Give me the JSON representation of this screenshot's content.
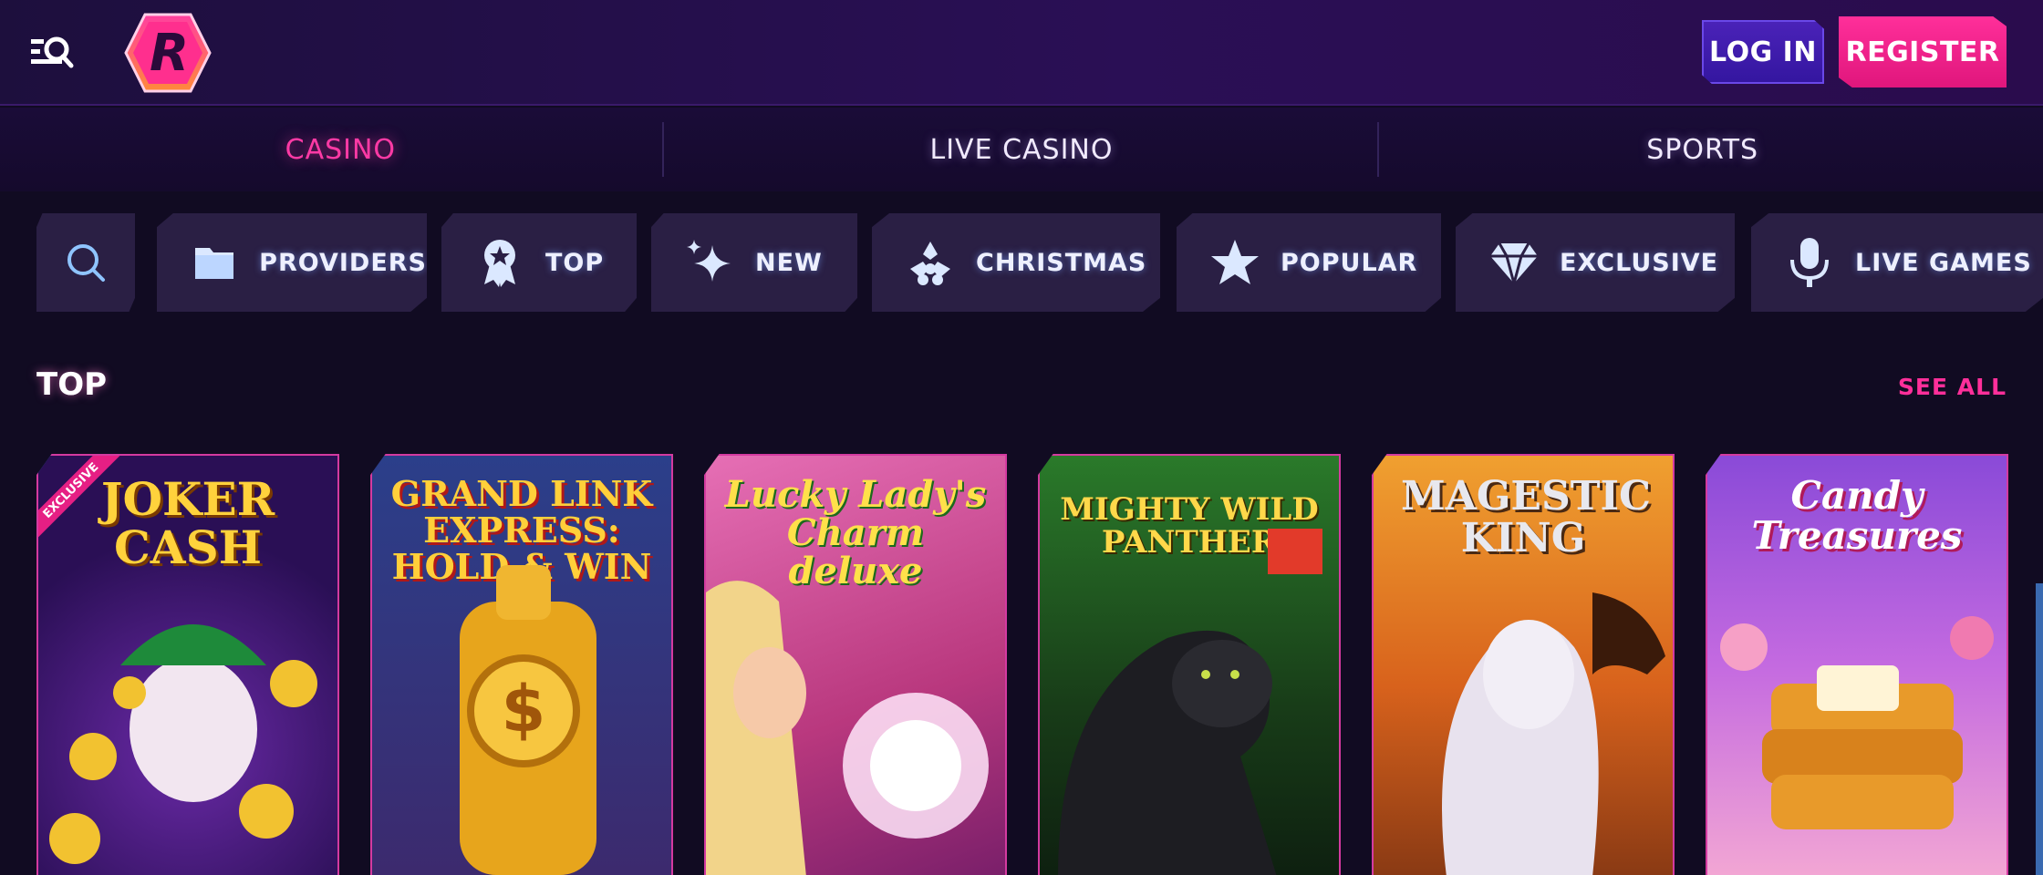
{
  "header": {
    "login_label": "LOG IN",
    "register_label": "REGISTER",
    "logo_letter": "R"
  },
  "topnav": {
    "tabs": [
      {
        "label": "CASINO",
        "active": true
      },
      {
        "label": "LIVE CASINO",
        "active": false
      },
      {
        "label": "SPORTS",
        "active": false
      }
    ]
  },
  "categories": [
    {
      "label": "",
      "icon": "search-icon"
    },
    {
      "label": "PROVIDERS",
      "icon": "folder-icon"
    },
    {
      "label": "TOP",
      "icon": "award-icon"
    },
    {
      "label": "NEW",
      "icon": "sparkles-icon"
    },
    {
      "label": "CHRISTMAS",
      "icon": "holly-icon"
    },
    {
      "label": "POPULAR",
      "icon": "star-icon"
    },
    {
      "label": "EXCLUSIVE",
      "icon": "diamond-icon"
    },
    {
      "label": "LIVE GAMES",
      "icon": "microphone-icon"
    }
  ],
  "section": {
    "title": "TOP",
    "see_all_label": "SEE ALL"
  },
  "games": [
    {
      "title": "JOKER CASH",
      "badge": "EXCLUSIVE"
    },
    {
      "title": "GRAND LINK EXPRESS: HOLD & WIN",
      "badge": ""
    },
    {
      "title": "Lucky Lady's Charm deluxe",
      "badge": ""
    },
    {
      "title": "MIGHTY WILD PANTHER",
      "badge": ""
    },
    {
      "title": "MAGESTIC KING",
      "badge": ""
    },
    {
      "title": "Candy Treasures",
      "badge": ""
    }
  ],
  "colors": {
    "accent_pink": "#ff2f9a",
    "accent_purple": "#3a1aa8",
    "background": "#110b22"
  }
}
